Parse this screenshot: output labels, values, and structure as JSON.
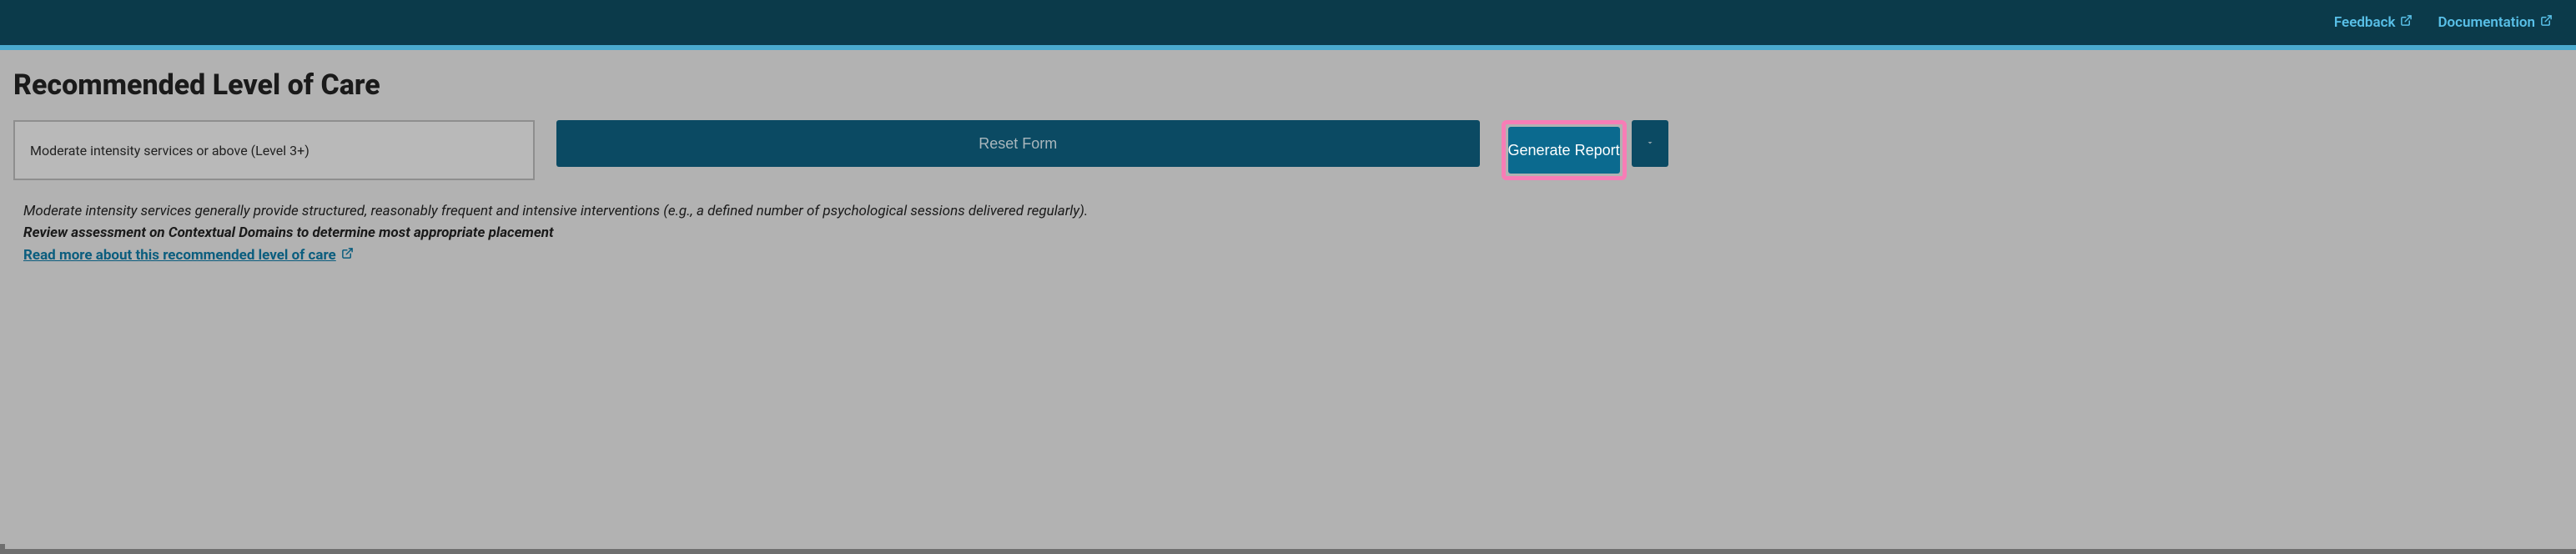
{
  "topbar": {
    "feedback_label": "Feedback",
    "documentation_label": "Documentation"
  },
  "page": {
    "title": "Recommended Level of Care"
  },
  "result": {
    "text": "Moderate intensity services or above (Level 3+)"
  },
  "buttons": {
    "reset_label": "Reset Form",
    "generate_label": "Generate Report"
  },
  "description": {
    "line1": "Moderate intensity services generally provide structured, reasonably frequent and intensive interventions (e.g., a defined number of psychological sessions delivered regularly).",
    "line2": "Review assessment on Contextual Domains to determine most appropriate placement",
    "link_label": "Read more about this recommended level of care"
  }
}
